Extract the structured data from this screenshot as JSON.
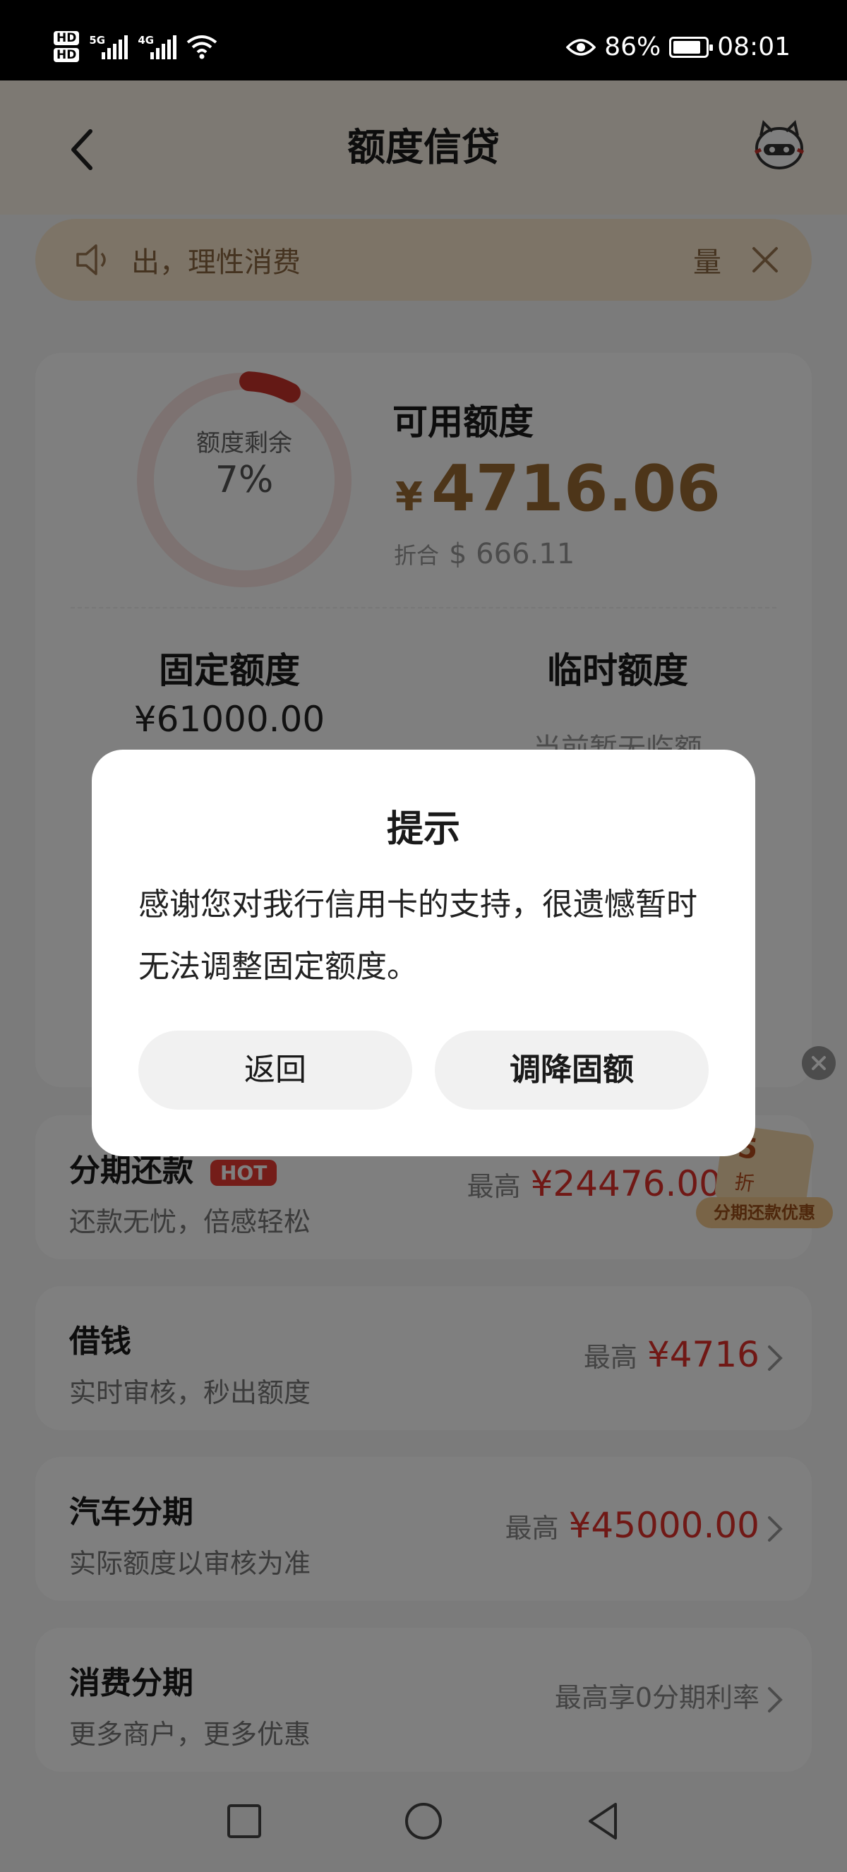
{
  "status_bar": {
    "battery": "86%",
    "time": "08:01",
    "hd1": "HD",
    "hd2": "HD",
    "net1": "5G",
    "net2": "4G"
  },
  "header": {
    "title": "额度信贷"
  },
  "notice": {
    "text": "出，理性消费",
    "tail": "量"
  },
  "limit_card": {
    "ring_label": "额度剩余",
    "ring_percent": "7%",
    "ring_fraction": 0.07,
    "available_label": "可用额度",
    "currency": "¥",
    "available_amount": "4716.06",
    "usd_prefix": "折合",
    "usd_amount": "$ 666.11",
    "fixed_label": "固定额度",
    "fixed_value": "¥61000.00",
    "temp_label": "临时额度",
    "temp_value": "当前暂无临额"
  },
  "list": [
    {
      "title": "分期还款",
      "badge": "HOT",
      "subtitle": "还款无忧，倍感轻松",
      "prefix": "最高",
      "amount": "¥24476.00"
    },
    {
      "title": "借钱",
      "subtitle": "实时审核，秒出额度",
      "prefix": "最高",
      "amount": "¥4716"
    },
    {
      "title": "汽车分期",
      "subtitle": "实际额度以审核为准",
      "prefix": "最高",
      "amount": "¥45000.00"
    },
    {
      "title": "消费分期",
      "subtitle": "更多商户，更多优惠",
      "plain": "最高享0分期利率"
    }
  ],
  "promo": {
    "num": "5",
    "unit": "折",
    "label": "分期还款优惠"
  },
  "dialog": {
    "title": "提示",
    "body": "感谢您对我行信用卡的支持，很遗憾暂时无法调整固定额度。",
    "back_label": "返回",
    "reduce_label": "调降固额"
  },
  "colors": {
    "accent_gold": "#9a6a32",
    "amount_red": "#e0302b",
    "ring_red": "#c8332b",
    "notice_bg": "#fbe9cf"
  }
}
